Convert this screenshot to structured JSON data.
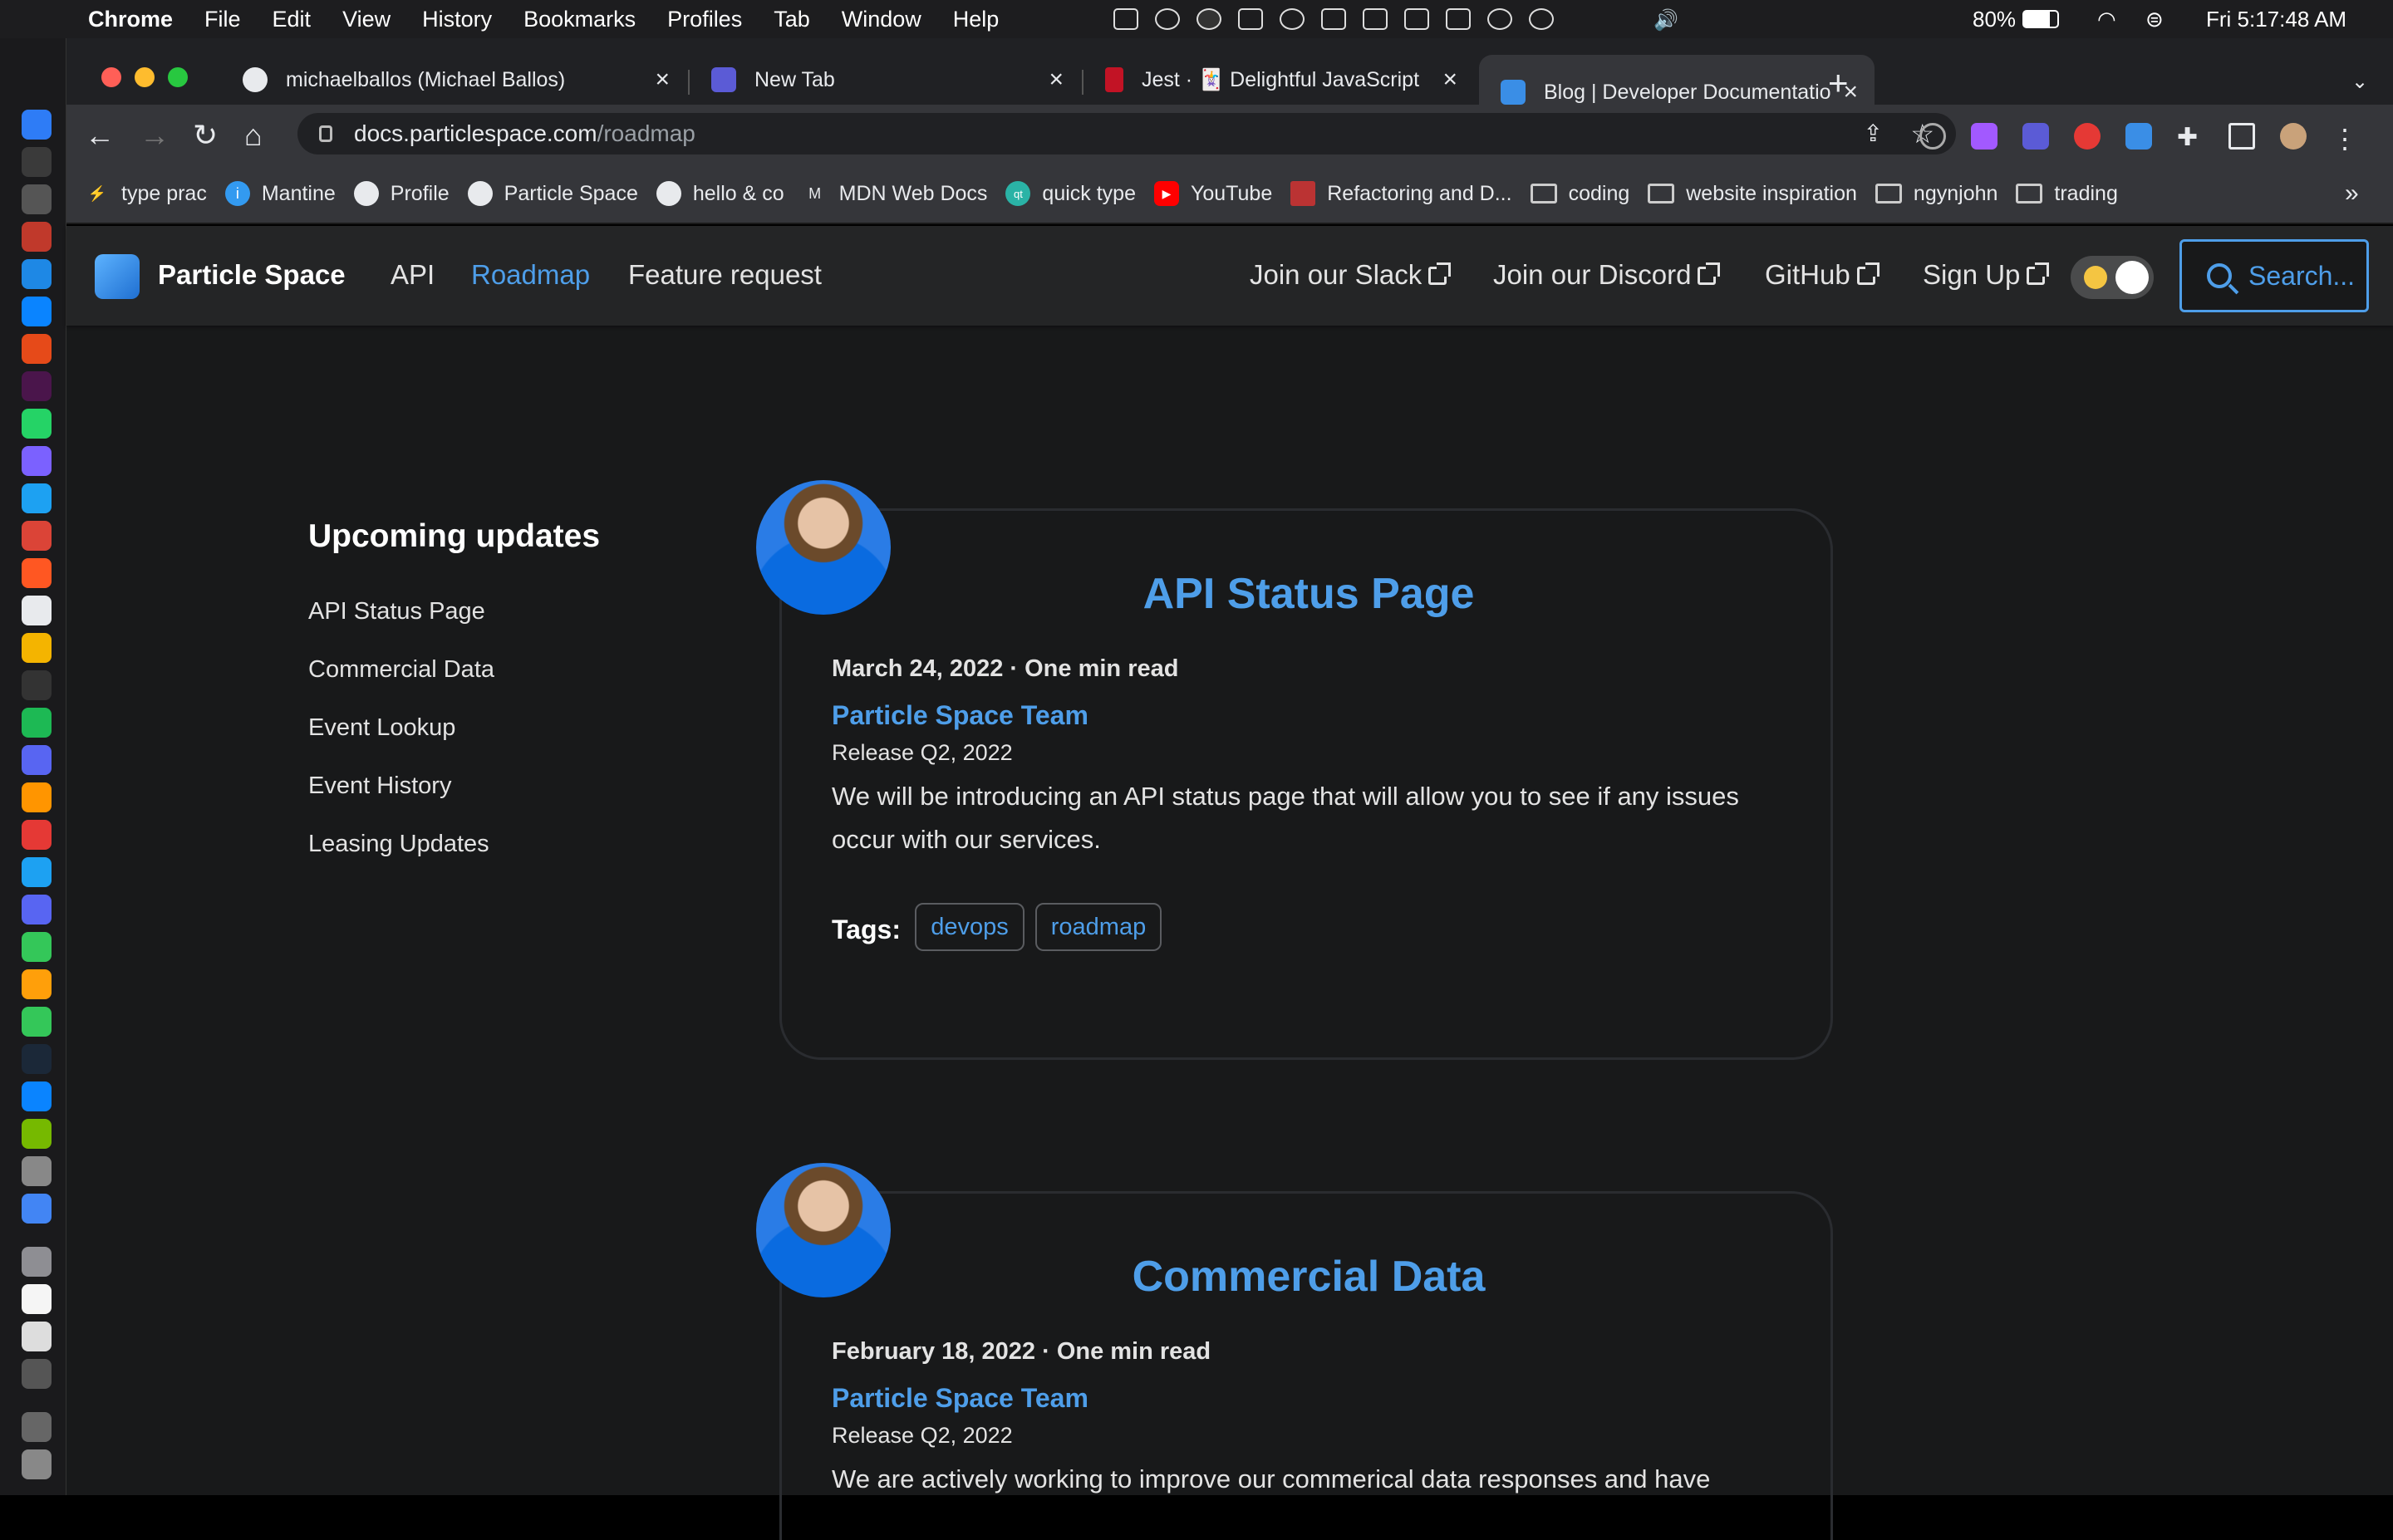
{
  "menubar": {
    "app": "Chrome",
    "items": [
      "File",
      "Edit",
      "View",
      "History",
      "Bookmarks",
      "Profiles",
      "Tab",
      "Window",
      "Help"
    ],
    "battery": "80%",
    "clock": "Fri  5:17:48 AM"
  },
  "tabs": [
    {
      "title": "michaelballos (Michael Ballos)"
    },
    {
      "title": "New Tab"
    },
    {
      "title": "Jest · 🃏 Delightful JavaScript"
    },
    {
      "title": "Blog | Developer Documentatio"
    }
  ],
  "omnibox": {
    "host": "docs.particlespace.com",
    "path": "/roadmap"
  },
  "bookmarks": [
    "type prac",
    "Mantine",
    "Profile",
    "Particle Space",
    "hello & co",
    "MDN Web Docs",
    "quick type",
    "YouTube",
    "Refactoring and D...",
    "coding",
    "website inspiration",
    "ngynjohn",
    "trading"
  ],
  "bookmarks_more": "»",
  "site": {
    "brand": "Particle Space",
    "nav": {
      "api": "API",
      "roadmap": "Roadmap",
      "feature": "Feature request"
    },
    "right": {
      "slack": "Join our Slack",
      "discord": "Join our Discord",
      "github": "GitHub",
      "signup": "Sign Up"
    },
    "search": "Search..."
  },
  "sidebar": {
    "title": "Upcoming updates",
    "items": [
      "API Status Page",
      "Commercial Data",
      "Event Lookup",
      "Event History",
      "Leasing Updates"
    ]
  },
  "posts": [
    {
      "title": "API Status Page",
      "meta": "March 24, 2022 · One min read",
      "author": "Particle Space Team",
      "release": "Release Q2, 2022",
      "body": "We will be introducing an API status page that will allow you to see if any issues occur with our services.",
      "tags_label": "Tags:",
      "tags": [
        "devops",
        "roadmap"
      ]
    },
    {
      "title": "Commercial Data",
      "meta": "February 18, 2022 · One min read",
      "author": "Particle Space Team",
      "release": "Release Q2, 2022",
      "body": "We are actively working to improve our commerical data responses and have"
    }
  ],
  "colors": {
    "accent": "#4e9ee9",
    "page_bg": "#18191a",
    "nav_bg": "#242526"
  }
}
